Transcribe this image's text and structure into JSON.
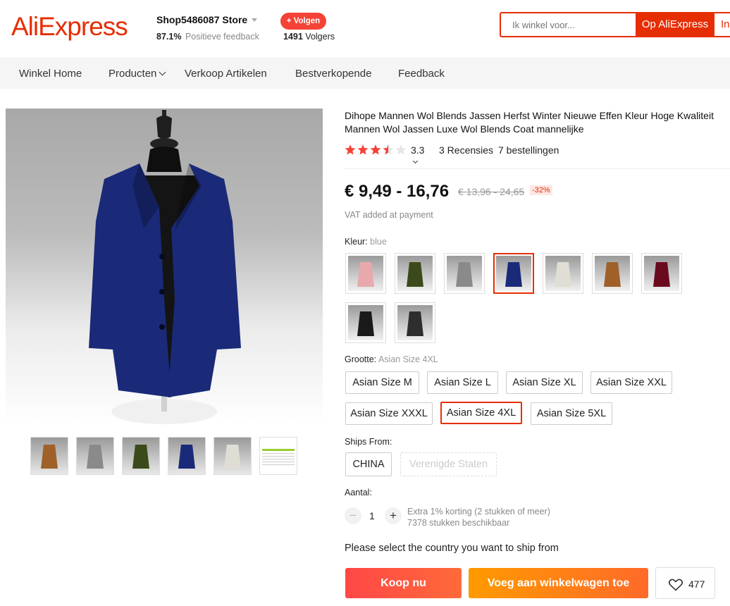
{
  "header": {
    "logo": "AliExpress",
    "store_name": "Shop5486087 Store",
    "feedback_pct": "87.1%",
    "feedback_label": "Positieve feedback",
    "follow_label": "+ Volgen",
    "followers_count": "1491",
    "followers_label": "Volgers",
    "search_placeholder": "Ik winkel voor...",
    "search_button": "Op AliExpress",
    "search_button2": "In"
  },
  "nav": {
    "items": [
      "Winkel Home",
      "Producten",
      "Verkoop Artikelen",
      "Bestverkopende",
      "Feedback"
    ]
  },
  "product": {
    "title": "Dihope Mannen Wol Blends Jassen Herfst Winter Nieuwe Effen Kleur Hoge Kwaliteit Mannen Wol Jassen Luxe Wol Blends Coat mannelijke",
    "rating": "3.3",
    "rating_stars": 3.5,
    "reviews": "3 Recensies",
    "orders": "7 bestellingen",
    "price": "€ 9,49 - 16,76",
    "old_price": "€ 13,96 - 24,65",
    "discount": "-32%",
    "vat": "VAT added at payment",
    "main_color": "#1a2a78"
  },
  "color_option": {
    "label": "Kleur:",
    "selected": "blue",
    "swatches": [
      {
        "name": "pink",
        "color": "#e8a9ad"
      },
      {
        "name": "army green",
        "color": "#3b4a1a"
      },
      {
        "name": "gray",
        "color": "#8a8a8a"
      },
      {
        "name": "blue",
        "color": "#1a2a78"
      },
      {
        "name": "white",
        "color": "#e0ddd4"
      },
      {
        "name": "camel",
        "color": "#a0602a"
      },
      {
        "name": "wine red",
        "color": "#6a0a1e"
      },
      {
        "name": "black",
        "color": "#1a1a1a"
      },
      {
        "name": "dark gray",
        "color": "#2e2e2e"
      }
    ]
  },
  "size_option": {
    "label": "Grootte:",
    "selected": "Asian Size 4XL",
    "sizes": [
      "Asian Size M",
      "Asian Size L",
      "Asian Size XL",
      "Asian Size XXL",
      "Asian Size XXXL",
      "Asian Size 4XL",
      "Asian Size 5XL"
    ]
  },
  "ships_from": {
    "label": "Ships From:",
    "options": [
      "CHINA",
      "Verenigde Staten"
    ]
  },
  "quantity": {
    "label": "Aantal:",
    "value": "1",
    "minus": "−",
    "plus": "+",
    "note1": "Extra 1% korting (2 stukken of meer)",
    "note2": "7378 stukken beschikbaar"
  },
  "ship_message": "Please select the country you want to ship from",
  "actions": {
    "buy_now": "Koop nu",
    "add_to_cart": "Voeg aan winkelwagen toe",
    "wishlist_count": "477"
  },
  "thumbnails": [
    {
      "name": "camel",
      "color": "#a0602a"
    },
    {
      "name": "gray",
      "color": "#8a8a8a"
    },
    {
      "name": "army green",
      "color": "#3b4a1a"
    },
    {
      "name": "blue",
      "color": "#1a2a78"
    },
    {
      "name": "white",
      "color": "#e0ddd4"
    },
    {
      "name": "size-chart",
      "color": "#9acd32"
    }
  ]
}
